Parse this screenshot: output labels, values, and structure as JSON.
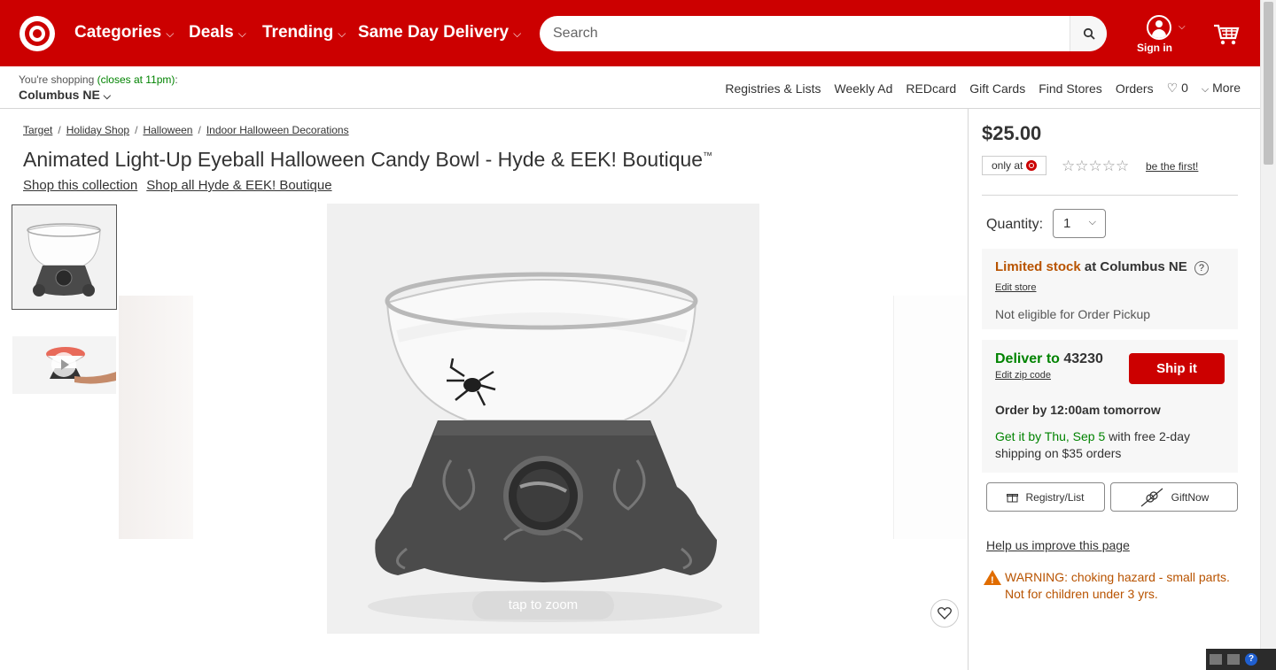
{
  "header": {
    "nav": [
      {
        "label": "Categories"
      },
      {
        "label": "Deals"
      },
      {
        "label": "Trending"
      },
      {
        "label": "Same Day Delivery"
      }
    ],
    "search_placeholder": "Search",
    "sign_in": "Sign in"
  },
  "subheader": {
    "shopping_prefix": "You're shopping",
    "closes": "(closes at 11pm)",
    "colon": ":",
    "store": "Columbus NE",
    "links": [
      "Registries & Lists",
      "Weekly Ad",
      "REDcard",
      "Gift Cards",
      "Find Stores",
      "Orders"
    ],
    "fav_count": "0",
    "more": "More"
  },
  "breadcrumb": [
    "Target",
    "Holiday Shop",
    "Halloween",
    "Indoor Halloween Decorations"
  ],
  "product": {
    "title": "Animated Light-Up Eyeball Halloween Candy Bowl - Hyde & EEK! Boutique",
    "tm": "™",
    "collection_link": "Shop this collection",
    "brand_link": "Shop all Hyde & EEK! Boutique",
    "zoom_hint": "tap to zoom"
  },
  "purchase": {
    "price": "$25.00",
    "only_at": "only at",
    "be_first": "be the first!",
    "quantity_label": "Quantity:",
    "quantity_value": "1",
    "limited_stock": "Limited stock",
    "at_store": "at Columbus NE",
    "edit_store": "Edit store",
    "pickup_note": "Not eligible for Order Pickup",
    "deliver_to": "Deliver to",
    "zip": "43230",
    "edit_zip": "Edit zip code",
    "ship_button": "Ship it",
    "order_by": "Order by 12:00am tomorrow",
    "get_it": "Get it by Thu, Sep 5",
    "shipping_note": "with free 2-day shipping on $35 orders",
    "registry_button": "Registry/List",
    "giftnow_button": "GiftNow",
    "help_link": "Help us improve this page",
    "warning_line1": "WARNING: choking hazard - small parts.",
    "warning_line2": "Not for children under 3 yrs."
  },
  "colors": {
    "brand_red": "#cc0000",
    "stock_orange": "#b85300",
    "green": "#008300"
  }
}
